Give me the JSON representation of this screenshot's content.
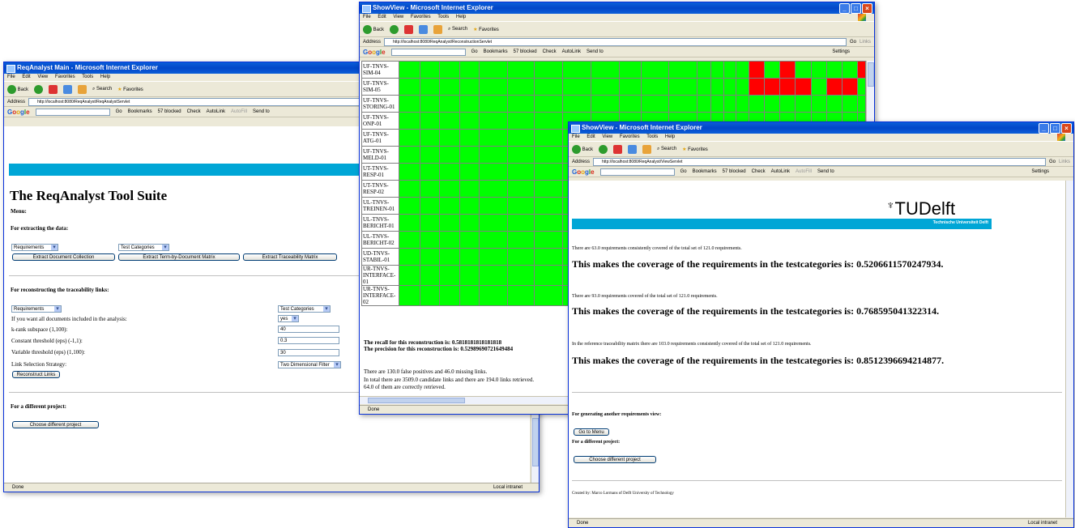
{
  "common": {
    "menu": [
      "File",
      "Edit",
      "View",
      "Favorites",
      "Tools",
      "Help"
    ],
    "back": "Back",
    "search": "Search",
    "favorites": "Favorites",
    "address_label": "Address",
    "go": "Go",
    "links": "Links",
    "google_bar": {
      "go": "Go",
      "bookmarks": "Bookmarks",
      "blocked": "57 blocked",
      "check": "Check",
      "autolink": "AutoLink",
      "autofill": "AutoFill",
      "sendto": "Send to",
      "settings": "Settings"
    },
    "status_done": "Done",
    "zone": "Local intranet"
  },
  "win1": {
    "title": "ReqAnalyst Main - Microsoft Internet Explorer",
    "url": "http://localhost:8080/ReqAnalyst/ReqAnalystServlet",
    "heading": "The ReqAnalyst Tool Suite",
    "menu_label": "Menu:",
    "extract_label": "For extracting the data:",
    "select_req": "Requirements",
    "select_test": "Test Categories",
    "btn_doc": "Extract Document Collection",
    "btn_term": "Extract Term-by-Document Matrix",
    "btn_trace": "Extract Traceability Matrix",
    "recon_label": "For reconstructing the traceability links:",
    "select_req2": "Requirements",
    "select_test2": "Test Categories",
    "all_docs_label": "If you want all documents included in the analysis:",
    "all_docs_value": "yes",
    "krank_label": "k-rank subspace (1,100):",
    "krank_value": "40",
    "const_label": "Constant threshold (eps) (-1,1):",
    "const_value": "0.3",
    "var_label": "Variable threshold (eps) (1,100):",
    "var_value": "30",
    "strategy_label": "Link Selection Strategy:",
    "strategy_value": "Two Dimensional Filter",
    "btn_reconstruct": "Reconstruct Links",
    "diff_label": "For a different project:",
    "btn_diff": "Choose different project"
  },
  "win2": {
    "title": "ShowView - Microsoft Internet Explorer",
    "url": "http://localhost:8080/ReqAnalyst/ReconstructionServlet",
    "rows": [
      {
        "label": "UF-TNVS-SIM-04",
        "cells": [
          "g",
          "g",
          "g",
          "g",
          "g",
          "g",
          "g",
          "g",
          "g",
          "g",
          "g",
          "g",
          "g",
          "g",
          "g",
          "g",
          "r",
          "g",
          "r",
          "g",
          "g",
          "g",
          "g",
          "r"
        ]
      },
      {
        "label": "UF-TNVS-SIM-05",
        "cells": [
          "g",
          "g",
          "g",
          "g",
          "g",
          "g",
          "g",
          "g",
          "g",
          "g",
          "g",
          "g",
          "g",
          "g",
          "g",
          "g",
          "r",
          "r",
          "r",
          "r",
          "g",
          "r",
          "r",
          "g"
        ]
      },
      {
        "label": "UF-TNVS-STORING-01",
        "cells": [
          "g",
          "g",
          "g",
          "g",
          "g",
          "g",
          "g",
          "g",
          "g",
          "g",
          "g",
          "g",
          "g",
          "g",
          "g",
          "g",
          "g",
          "g",
          "g",
          "g",
          "g",
          "g",
          "g",
          "g"
        ]
      },
      {
        "label": "UF-TNVS-ONP-01",
        "cells": [
          "g",
          "g",
          "g",
          "g",
          "g",
          "g",
          "g",
          "g",
          "g",
          "g",
          "g",
          "g",
          "g",
          "g",
          "g",
          "g",
          "g",
          "g",
          "g",
          "g",
          "g",
          "g",
          "g",
          "g"
        ]
      },
      {
        "label": "UF-TNVS-ATG-01",
        "cells": [
          "g",
          "g",
          "g",
          "g",
          "g",
          "g",
          "g",
          "g",
          "g",
          "g",
          "g",
          "g",
          "g",
          "g",
          "g",
          "g",
          "g",
          "g",
          "g",
          "g",
          "g",
          "g",
          "g",
          "g"
        ]
      },
      {
        "label": "UF-TNVS-MELD-01",
        "cells": [
          "g",
          "g",
          "g",
          "g",
          "g",
          "g",
          "g",
          "g",
          "g",
          "g",
          "g",
          "g",
          "g",
          "g",
          "g",
          "g",
          "g",
          "g",
          "g",
          "g",
          "g",
          "g",
          "g",
          "g"
        ]
      },
      {
        "label": "UT-TNVS-RESP-01",
        "cells": [
          "g",
          "g",
          "g",
          "g",
          "g",
          "g",
          "g",
          "g",
          "g",
          "g",
          "g",
          "g",
          "g",
          "g",
          "g",
          "g",
          "g",
          "g",
          "g",
          "g",
          "g",
          "g",
          "g",
          "g"
        ]
      },
      {
        "label": "UT-TNVS-RESP-02",
        "cells": [
          "g",
          "g",
          "g",
          "g",
          "g",
          "g",
          "g",
          "g",
          "g",
          "g",
          "g",
          "g",
          "g",
          "g",
          "g",
          "g",
          "g",
          "g",
          "g",
          "g",
          "g",
          "g",
          "g",
          "g"
        ]
      },
      {
        "label": "UL-TNVS-TREINEN-01",
        "cells": [
          "g",
          "g",
          "g",
          "g",
          "g",
          "g",
          "g",
          "g",
          "g",
          "g",
          "g",
          "g",
          "g",
          "g",
          "g",
          "g",
          "g",
          "g",
          "g",
          "g",
          "g",
          "g",
          "g",
          "g"
        ]
      },
      {
        "label": "UL-TNVS-BERICHT-01",
        "cells": [
          "g",
          "g",
          "g",
          "g",
          "g",
          "g",
          "g",
          "g",
          "g",
          "g",
          "g",
          "g",
          "g",
          "g",
          "g",
          "g",
          "g",
          "g",
          "g",
          "g",
          "g",
          "g",
          "g",
          "g"
        ]
      },
      {
        "label": "UL-TNVS-BERICHT-02",
        "cells": [
          "g",
          "g",
          "g",
          "g",
          "g",
          "g",
          "g",
          "g",
          "g",
          "g",
          "g",
          "g",
          "g",
          "g",
          "g",
          "g",
          "g",
          "g",
          "g",
          "g",
          "g",
          "g",
          "g",
          "g"
        ]
      },
      {
        "label": "UD-TNVS-STABIL-01",
        "cells": [
          "g",
          "g",
          "g",
          "g",
          "g",
          "g",
          "g",
          "g",
          "g",
          "g",
          "g",
          "g",
          "g",
          "g",
          "g",
          "g",
          "g",
          "g",
          "g",
          "g",
          "g",
          "g",
          "g",
          "g"
        ]
      },
      {
        "label": "UR-TNVS-INTERFACE-01",
        "cells": [
          "g",
          "g",
          "g",
          "g",
          "g",
          "g",
          "g",
          "g",
          "g",
          "g",
          "g",
          "g",
          "g",
          "g",
          "g",
          "g",
          "g",
          "g",
          "g",
          "g",
          "g",
          "g",
          "g",
          "g"
        ]
      },
      {
        "label": "UR-TNVS-INTERFACE-02",
        "cells": [
          "g",
          "g",
          "g",
          "g",
          "g",
          "g",
          "g",
          "g",
          "g",
          "g",
          "g",
          "g",
          "g",
          "g",
          "g",
          "g",
          "g",
          "g",
          "g",
          "g",
          "g",
          "g",
          "g",
          "g"
        ]
      }
    ],
    "recall": "The recall for this reconstruction is: 0.5818181818181818",
    "precision": "The precision for this reconstruction is: 0.5298969072164948​4",
    "fp": "There are 130.0 false positives and 46.0 missing links.",
    "total": "In total there are 3509.0 candidate links and there are 194.0 links retrieved.",
    "correct": "64.0 of them are correctly retrieved."
  },
  "win3": {
    "title": "ShowView - Microsoft Internet Explorer",
    "url": "http://localhost:8080/ReqAnalyst/ViewServlet",
    "logo_name": "TUDelft",
    "logo_sub": "Technische Universiteit Delft",
    "p1": "There are 63.0 requirements consistently covered of the total set of 121.0 requirements.",
    "h1": "This makes the coverage of the requirements in the testcategories is: 0.5206611570247934.",
    "p2": "There are 93.0 requirements covered of the total set of 121.0 requirements.",
    "h2": "This makes the coverage of the requirements in the testcategories is: 0.768595041322314.",
    "p3": "In the reference traceability matrix there are 103.0 requirements consistently covered of the total set of 121.0 requirements.",
    "h3": "This makes the coverage of the requirements in the testcategories is: 0.8512396694214877.",
    "gen_label": "For generating another requirements view:",
    "btn_menu": "Go to Menu",
    "diff_label": "For a different project:",
    "btn_diff": "Choose different project",
    "created": "Created by: Marco Lormans of Delft University of Technology"
  },
  "colors": {
    "title_blue": "#0a5ed8",
    "cyan_band": "#00a6d6",
    "covered_green": "#00ff00",
    "missing_red": "#ff0000"
  }
}
